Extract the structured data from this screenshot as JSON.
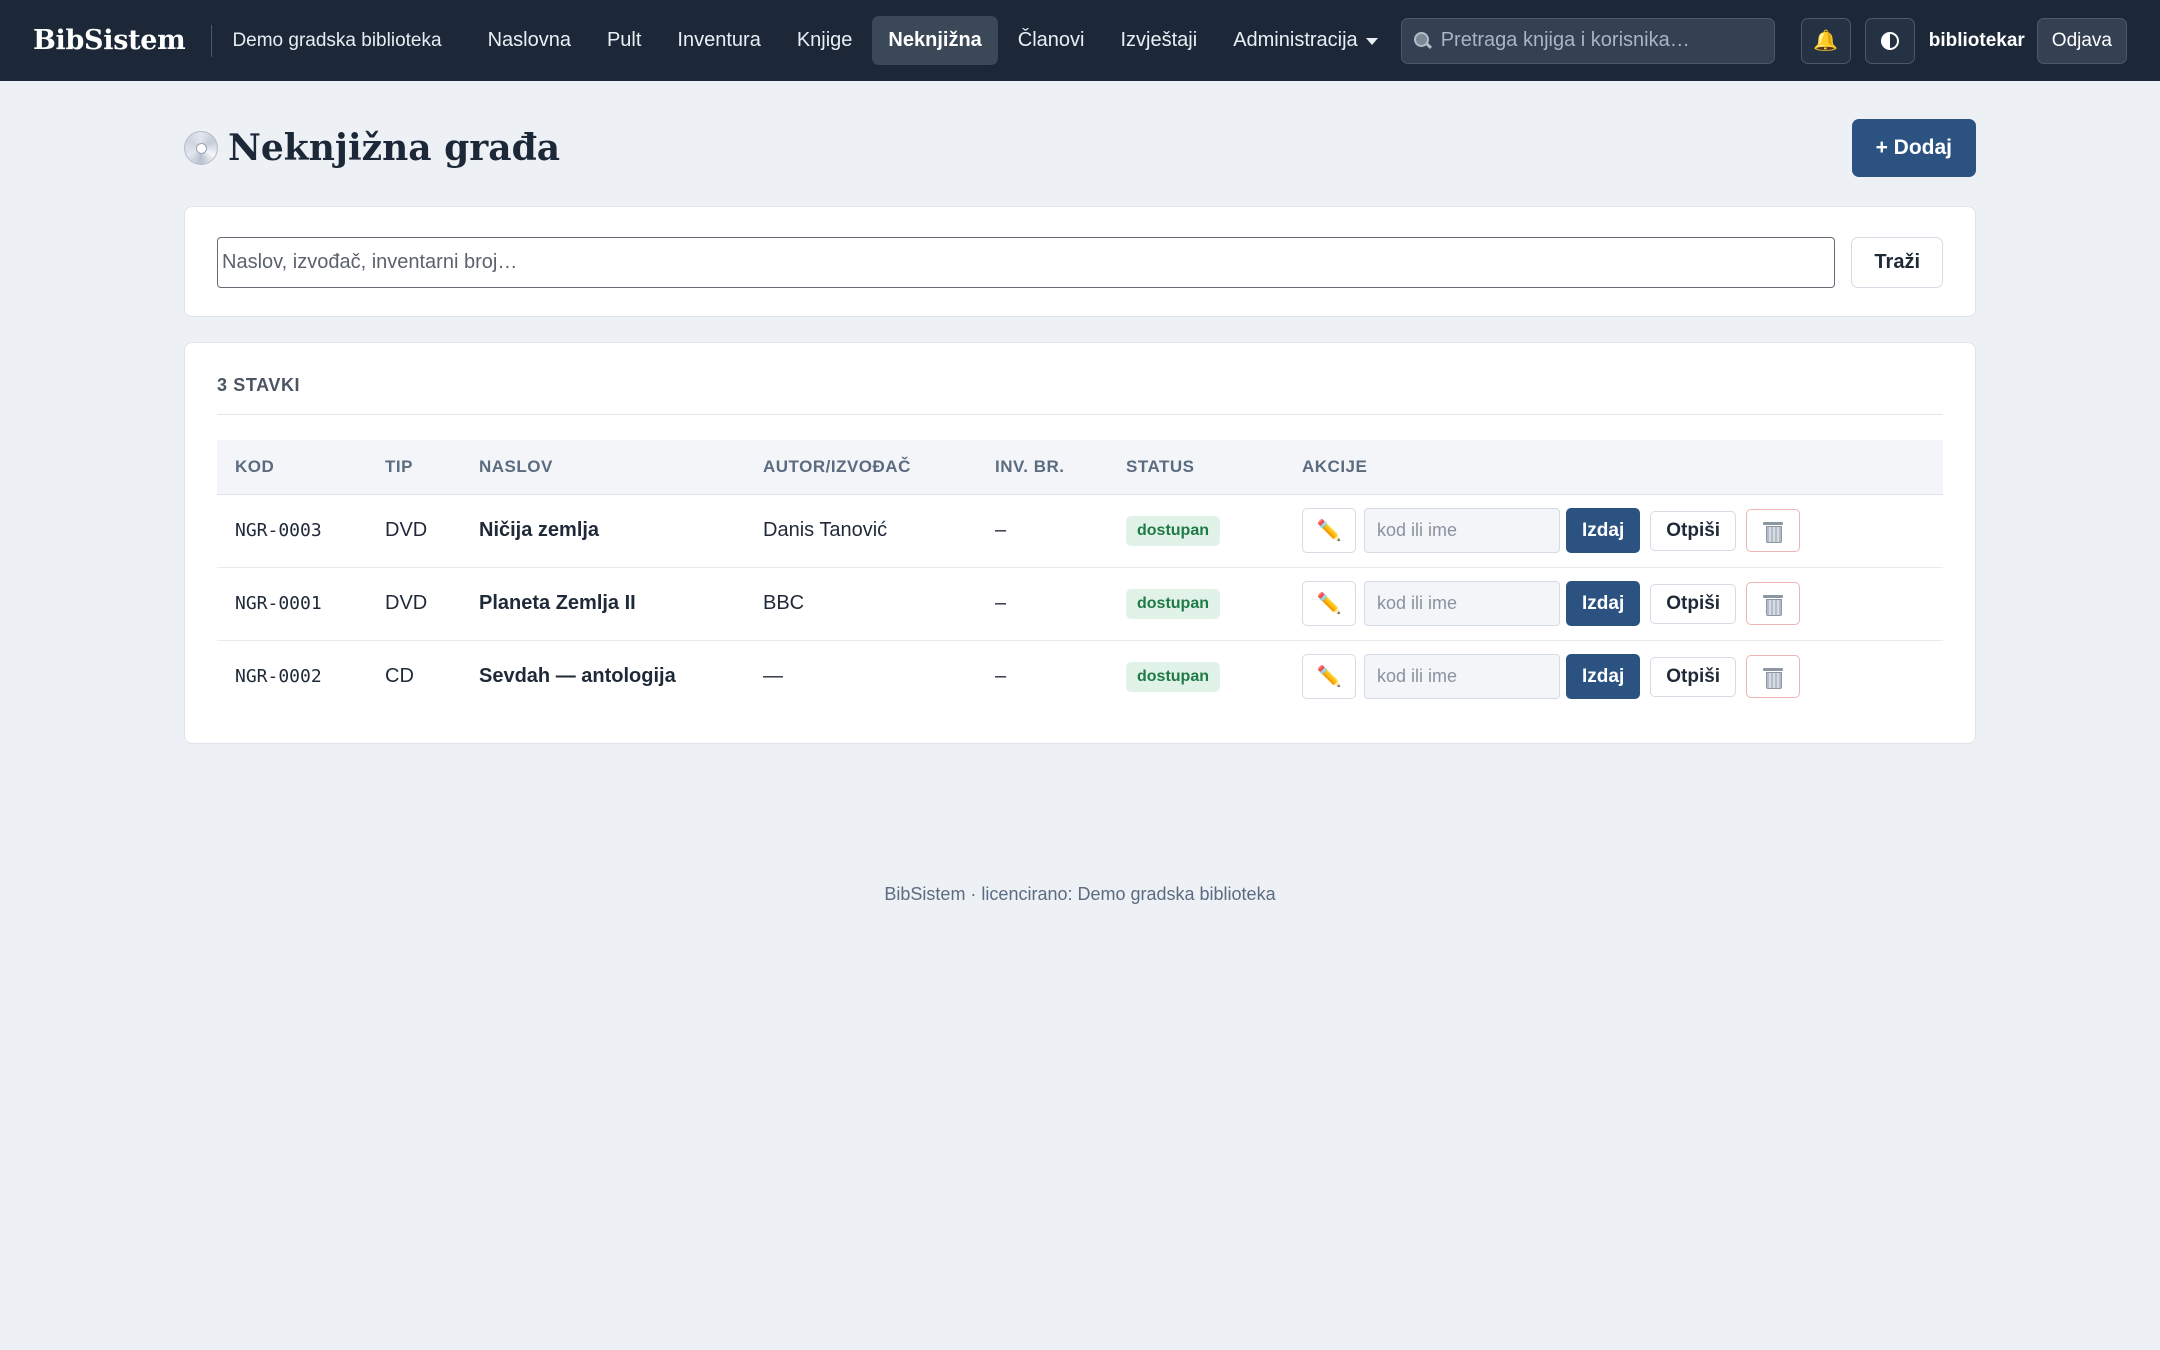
{
  "header": {
    "brand": "BibSistem",
    "org": "Demo gradska biblioteka",
    "nav": [
      {
        "label": "Naslovna"
      },
      {
        "label": "Pult"
      },
      {
        "label": "Inventura"
      },
      {
        "label": "Knjige"
      },
      {
        "label": "Neknjižna"
      },
      {
        "label": "Članovi"
      },
      {
        "label": "Izvještaji"
      },
      {
        "label": "Administracija"
      }
    ],
    "search_placeholder": "Pretraga knjiga i korisnika…",
    "username": "bibliotekar",
    "logout": "Odjava"
  },
  "page": {
    "title": "Neknjižna građa",
    "add_button": "+ Dodaj",
    "search_placeholder": "Naslov, izvođač, inventarni broj…",
    "search_button": "Traži",
    "count": "3 STAVKI"
  },
  "table": {
    "columns": [
      "KOD",
      "TIP",
      "NASLOV",
      "AUTOR/IZVOĐAČ",
      "INV. BR.",
      "STATUS",
      "AKCIJE"
    ],
    "rows": [
      {
        "code": "NGR-0003",
        "type": "DVD",
        "title": "Ničija zemlja",
        "author": "Danis Tanović",
        "inv": "–",
        "status": "dostupan"
      },
      {
        "code": "NGR-0001",
        "type": "DVD",
        "title": "Planeta Zemlja II",
        "author": "BBC",
        "inv": "–",
        "status": "dostupan"
      },
      {
        "code": "NGR-0002",
        "type": "CD",
        "title": "Sevdah — antologija",
        "author": "—",
        "inv": "–",
        "status": "dostupan"
      }
    ],
    "issue_placeholder": "kod ili ime",
    "issue_button": "Izdaj",
    "writeoff_button": "Otpiši"
  },
  "footer": {
    "text": "BibSistem · licencirano: Demo gradska biblioteka"
  },
  "icons": {
    "search": "magnifier-icon",
    "notifications": "bell-icon",
    "theme": "contrast-icon",
    "page": "disc-icon",
    "edit": "pencil-icon",
    "delete": "trash-icon"
  },
  "colors": {
    "topbar": "#1c2838",
    "primary": "#2c5282",
    "status_available_bg": "#e1f3e8",
    "status_available_text": "#1f7a46"
  }
}
